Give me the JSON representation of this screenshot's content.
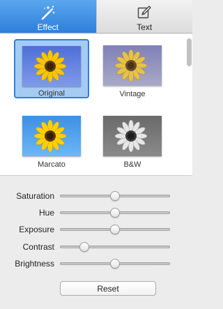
{
  "tabs": [
    {
      "label": "Effect",
      "icon": "magic-wand-icon",
      "active": true
    },
    {
      "label": "Text",
      "icon": "edit-text-icon",
      "active": false
    }
  ],
  "filters": [
    {
      "label": "Original",
      "selected": true,
      "style": "original"
    },
    {
      "label": "Vintage",
      "selected": false,
      "style": "vintage"
    },
    {
      "label": "Marcato",
      "selected": false,
      "style": "marcato"
    },
    {
      "label": "B&W",
      "selected": false,
      "style": "bw"
    }
  ],
  "adjustments": [
    {
      "label": "Saturation",
      "value": 0.5
    },
    {
      "label": "Hue",
      "value": 0.5
    },
    {
      "label": "Exposure",
      "value": 0.5
    },
    {
      "label": "Contrast",
      "value": 0.22
    },
    {
      "label": "Brightness",
      "value": 0.5
    }
  ],
  "reset_label": "Reset",
  "colors": {
    "accent": "#2f7fda",
    "selected_fill": "#a6cbf3"
  }
}
